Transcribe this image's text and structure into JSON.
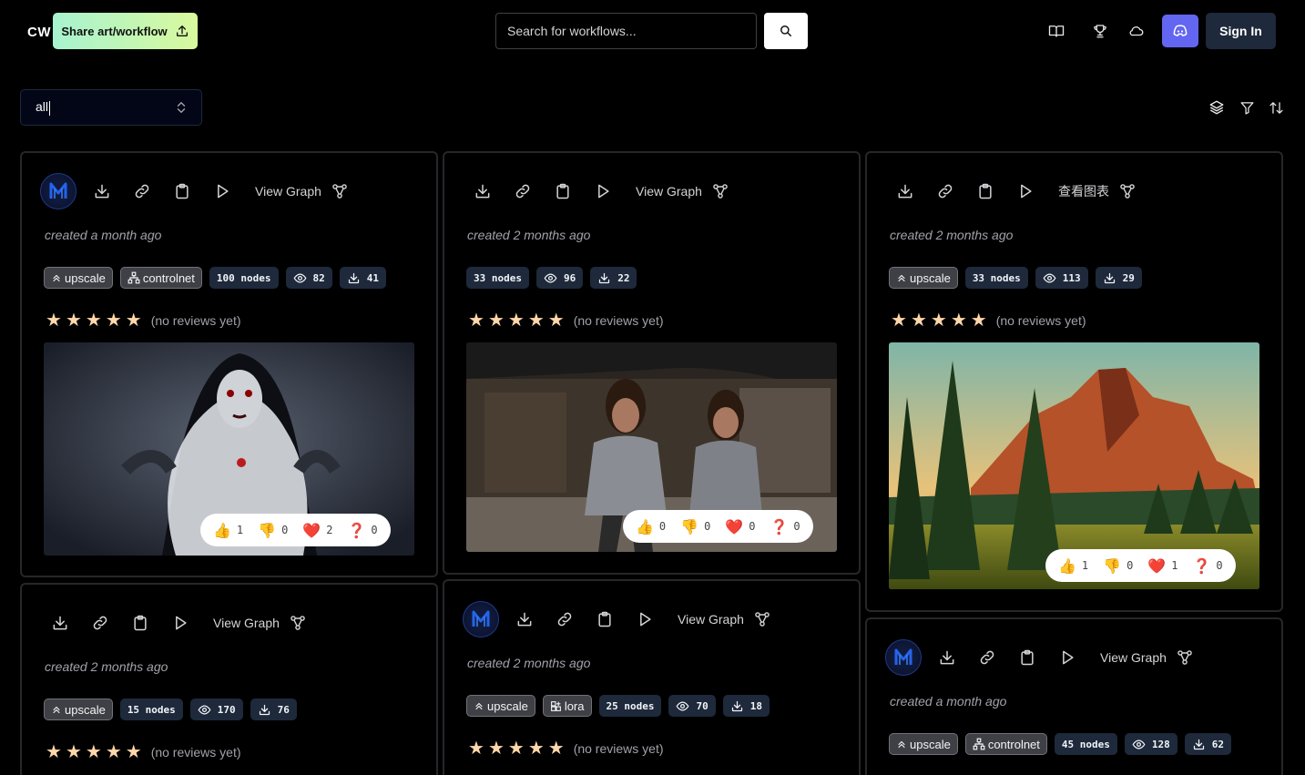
{
  "header": {
    "logo": "CW",
    "share_label": "Share art/workflow",
    "search_placeholder": "Search for workflows...",
    "sign_in": "Sign In"
  },
  "filter": {
    "selected": "all"
  },
  "cards": [
    {
      "view_graph": "View Graph",
      "created": "created a month ago",
      "tags": [
        "upscale",
        "controlnet"
      ],
      "nodes": "100 nodes",
      "views": "82",
      "downloads": "41",
      "reviews": "(no reviews yet)",
      "reactions": {
        "thumbs_up": "1",
        "thumbs_down": "0",
        "heart": "2",
        "question": "0"
      }
    },
    {
      "view_graph": "View Graph",
      "created": "created 2 months ago",
      "tags": [],
      "nodes": "33 nodes",
      "views": "96",
      "downloads": "22",
      "reviews": "(no reviews yet)",
      "reactions": {
        "thumbs_up": "0",
        "thumbs_down": "0",
        "heart": "0",
        "question": "0"
      }
    },
    {
      "view_graph": "查看图表",
      "created": "created 2 months ago",
      "tags": [
        "upscale"
      ],
      "nodes": "33 nodes",
      "views": "113",
      "downloads": "29",
      "reviews": "(no reviews yet)",
      "reactions": {
        "thumbs_up": "1",
        "thumbs_down": "0",
        "heart": "1",
        "question": "0"
      }
    },
    {
      "view_graph": "View Graph",
      "created": "created 2 months ago",
      "tags": [
        "upscale"
      ],
      "nodes": "15 nodes",
      "views": "170",
      "downloads": "76",
      "reviews": "(no reviews yet)"
    },
    {
      "view_graph": "View Graph",
      "created": "created 2 months ago",
      "tags": [
        "upscale",
        "lora"
      ],
      "nodes": "25 nodes",
      "views": "70",
      "downloads": "18",
      "reviews": "(no reviews yet)"
    },
    {
      "view_graph": "View Graph",
      "created": "created a month ago",
      "tags": [
        "upscale",
        "controlnet"
      ],
      "nodes": "45 nodes",
      "views": "128",
      "downloads": "62"
    }
  ]
}
